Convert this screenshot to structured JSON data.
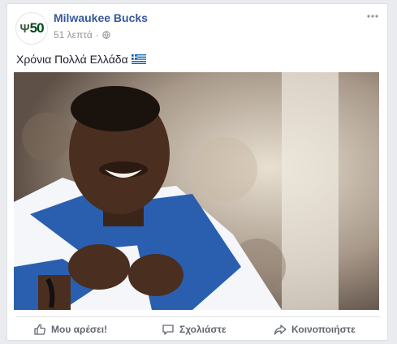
{
  "post": {
    "page_name": "Milwaukee Bucks",
    "avatar_text": "50",
    "timestamp": "51 λεπτά",
    "separator": "·",
    "text": "Χρόνια Πολλά Ελλάδα",
    "flag_icon": "greece-flag-icon",
    "photo_description_icon": "photo"
  },
  "actions": {
    "like_label": "Μου αρέσει!",
    "comment_label": "Σχολιάστε",
    "share_label": "Κοινοποιήστε"
  },
  "colors": {
    "link": "#365899",
    "meta": "#90949c",
    "action": "#616770",
    "brand_green": "#00471b"
  }
}
